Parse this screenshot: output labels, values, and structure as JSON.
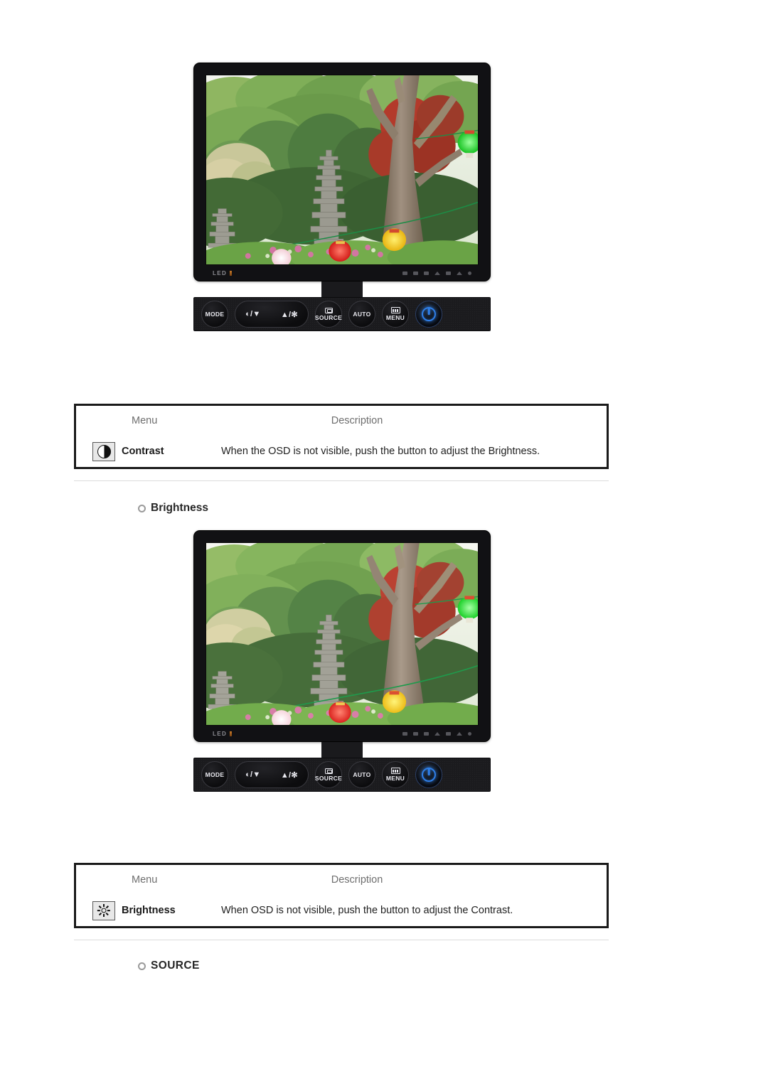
{
  "page": {
    "background": "#ffffff"
  },
  "monitor": {
    "led_label": "LED",
    "controls": [
      {
        "name": "mode",
        "label": "MODE",
        "glyph": ""
      },
      {
        "name": "contrast-down",
        "label": "",
        "glyph": "◐/▼"
      },
      {
        "name": "brightness-up",
        "label": "",
        "glyph": "▲/✻"
      },
      {
        "name": "source",
        "label": "SOURCE",
        "glyph": "screen-enter"
      },
      {
        "name": "auto",
        "label": "AUTO",
        "glyph": ""
      },
      {
        "name": "menu",
        "label": "MENU",
        "glyph": "menu-grid"
      },
      {
        "name": "power",
        "label": "",
        "glyph": "power"
      }
    ],
    "accent_power_color": "#2f7fe8",
    "bezel_color": "#111114",
    "led_indicator_color": "#c87a2a"
  },
  "tables": [
    {
      "id": "contrast-table",
      "headers": {
        "menu": "Menu",
        "description": "Description"
      },
      "row": {
        "icon": "contrast-icon",
        "menu": "Contrast",
        "description": "When the OSD is not visible, push the button to adjust the Brightness."
      }
    },
    {
      "id": "brightness-table",
      "headers": {
        "menu": "Menu",
        "description": "Description"
      },
      "row": {
        "icon": "brightness-sun-icon",
        "menu": "Brightness",
        "description": "When OSD is not visible, push the button to adjust the Contrast."
      }
    }
  ],
  "headings": [
    {
      "id": "brightness-heading",
      "text": "Brightness"
    },
    {
      "id": "source-heading",
      "text": "SOURCE"
    }
  ]
}
